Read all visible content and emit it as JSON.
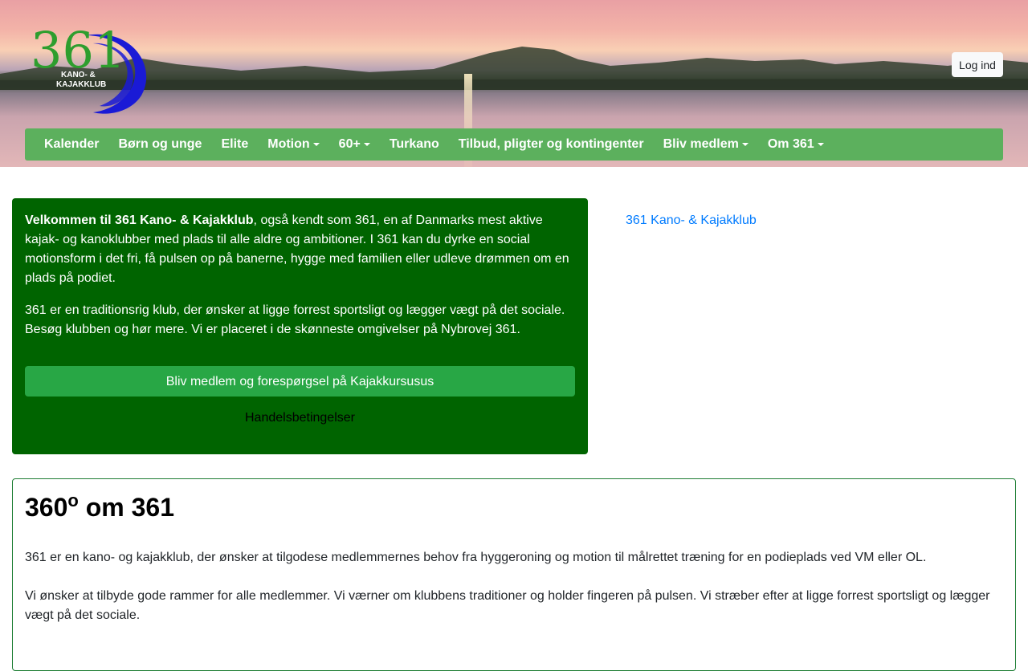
{
  "header": {
    "logo": {
      "number": "361",
      "line1": "KANO- &",
      "line2": "KAJAKKLUB"
    },
    "login_label": "Log ind"
  },
  "nav": {
    "items": [
      {
        "label": "Kalender",
        "dropdown": false
      },
      {
        "label": "Børn og unge",
        "dropdown": false
      },
      {
        "label": "Elite",
        "dropdown": false
      },
      {
        "label": "Motion",
        "dropdown": true
      },
      {
        "label": "60+",
        "dropdown": true
      },
      {
        "label": "Turkano",
        "dropdown": false
      },
      {
        "label": "Tilbud, pligter og kontingenter",
        "dropdown": false
      },
      {
        "label": "Bliv medlem",
        "dropdown": true
      },
      {
        "label": "Om 361",
        "dropdown": true
      }
    ]
  },
  "welcome": {
    "intro_bold": "Velkommen til 361 Kano- & Kajakklub",
    "intro_rest": ", også kendt som 361, en af Danmarks mest aktive kajak- og kanoklubber med plads til alle aldre og ambitioner. I 361 kan du dyrke en social motionsform i det fri, få pulsen op på banerne, hygge med familien eller udleve drømmen om en plads på podiet.",
    "para2": "361 er en traditionsrig klub, der ønsker at ligge forrest sportsligt og lægger vægt på det sociale. Besøg klubben og hør mere. Vi er placeret i de skønneste omgivelser på Nybrovej 361.",
    "cta_label": "Bliv medlem og forespørgsel på Kajakkursusus",
    "terms_label": "Handelsbetingelser"
  },
  "side": {
    "link_label": "361 Kano- & Kajakklub"
  },
  "about": {
    "title_number": "360",
    "title_sup": "o",
    "title_rest": " om 361",
    "para1": "361 er en kano- og kajakklub, der ønsker at tilgodese medlemmernes behov fra hyggeroning og motion til målrettet træning for en podieplads ved VM eller OL.",
    "para2": "Vi ønsker at tilbyde gode rammer for alle medlemmer. Vi værner om klubbens traditioner og holder fingeren på pulsen. Vi stræber efter at ligge forrest sportsligt og lægger vægt på det sociale."
  },
  "colors": {
    "nav_bg": "#5cb05d",
    "welcome_bg": "#006400",
    "cta_bg": "#28a745",
    "link": "#007bff",
    "about_border": "#1e7e34",
    "logo_green": "#2e9e2e",
    "logo_blue": "#1a1ad6"
  }
}
